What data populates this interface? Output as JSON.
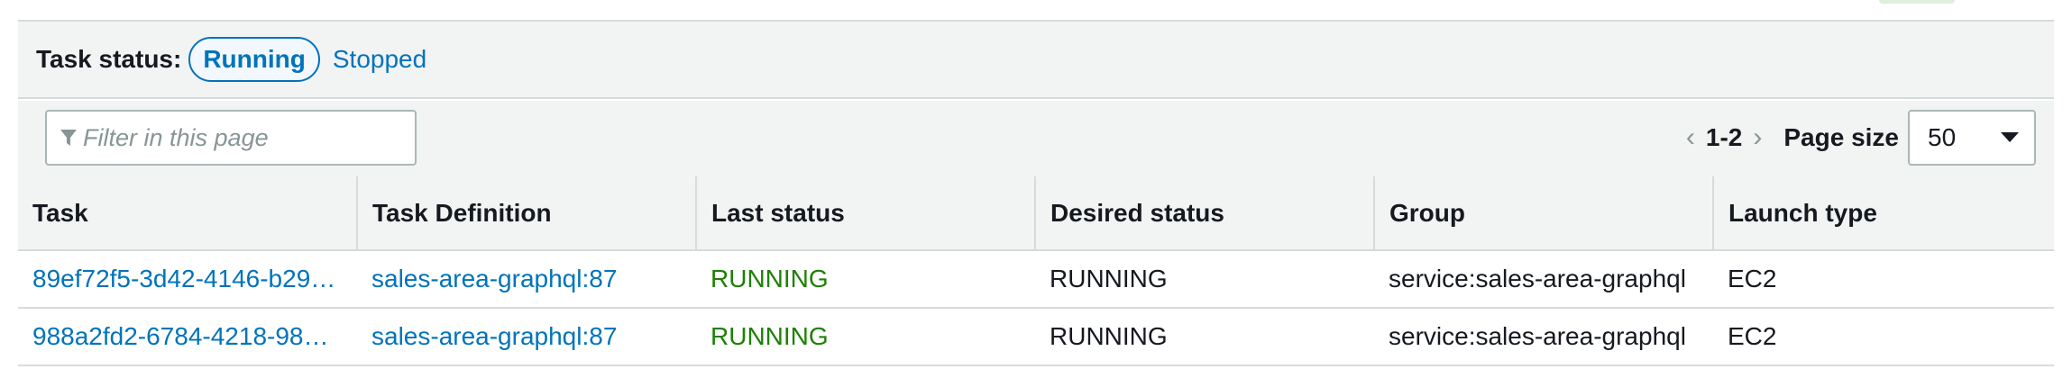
{
  "task_status": {
    "label": "Task status:",
    "options": [
      {
        "label": "Running",
        "active": true
      },
      {
        "label": "Stopped",
        "active": false
      }
    ]
  },
  "filter": {
    "placeholder": "Filter in this page",
    "icon": "filter-icon"
  },
  "pagination": {
    "prev_icon": "chevron-left-icon",
    "range": "1-2",
    "next_icon": "chevron-right-icon",
    "page_size_label": "Page size",
    "page_size_value": "50"
  },
  "table": {
    "columns": [
      "Task",
      "Task Definition",
      "Last status",
      "Desired status",
      "Group",
      "Launch type"
    ],
    "rows": [
      {
        "task": "89ef72f5-3d42-4146-b29…",
        "task_definition": "sales-area-graphql:87",
        "last_status": "RUNNING",
        "desired_status": "RUNNING",
        "group": "service:sales-area-graphql",
        "launch_type": "EC2"
      },
      {
        "task": "988a2fd2-6784-4218-98…",
        "task_definition": "sales-area-graphql:87",
        "last_status": "RUNNING",
        "desired_status": "RUNNING",
        "group": "service:sales-area-graphql",
        "launch_type": "EC2"
      }
    ]
  },
  "colors": {
    "link": "#0073bb",
    "running": "#1d8102",
    "header_bg": "#f2f3f3",
    "border": "#d5dbdb"
  }
}
